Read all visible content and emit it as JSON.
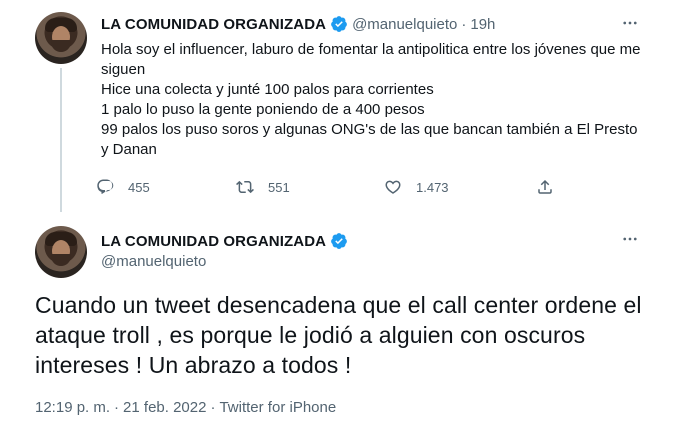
{
  "tweet1": {
    "display_name": "LA COMUNIDAD ORGANIZADA",
    "handle": "@manuelquieto",
    "separator": "·",
    "time": "19h",
    "lines": [
      "Hola soy el influencer, laburo de fomentar la antipolitica entre los jóvenes que me siguen",
      "Hice una colecta y junté 100 palos para corrientes",
      "1 palo lo puso la gente poniendo de a 400 pesos",
      "99 palos los puso soros y algunas ONG's de las que bancan también a El Presto y Danan"
    ],
    "actions": {
      "replies": "455",
      "retweets": "551",
      "likes": "1.473"
    }
  },
  "tweet2": {
    "display_name": "LA COMUNIDAD ORGANIZADA",
    "handle": "@manuelquieto",
    "text": "Cuando un tweet desencadena que el call center ordene el ataque troll , es porque le jodió a alguien con oscuros intereses ! Un abrazo a todos !",
    "time": "12:19 p. m.",
    "date": "21 feb. 2022",
    "source": "Twitter for iPhone",
    "separator": "·"
  },
  "icons": {
    "verified": "verified-badge-icon",
    "more": "more-dots-icon",
    "reply": "reply-icon",
    "retweet": "retweet-icon",
    "like": "heart-icon",
    "share": "share-icon"
  },
  "colors": {
    "text": "#0f1419",
    "secondary": "#536471",
    "verified": "#1d9bf0",
    "thread_line": "#cfd9de"
  }
}
